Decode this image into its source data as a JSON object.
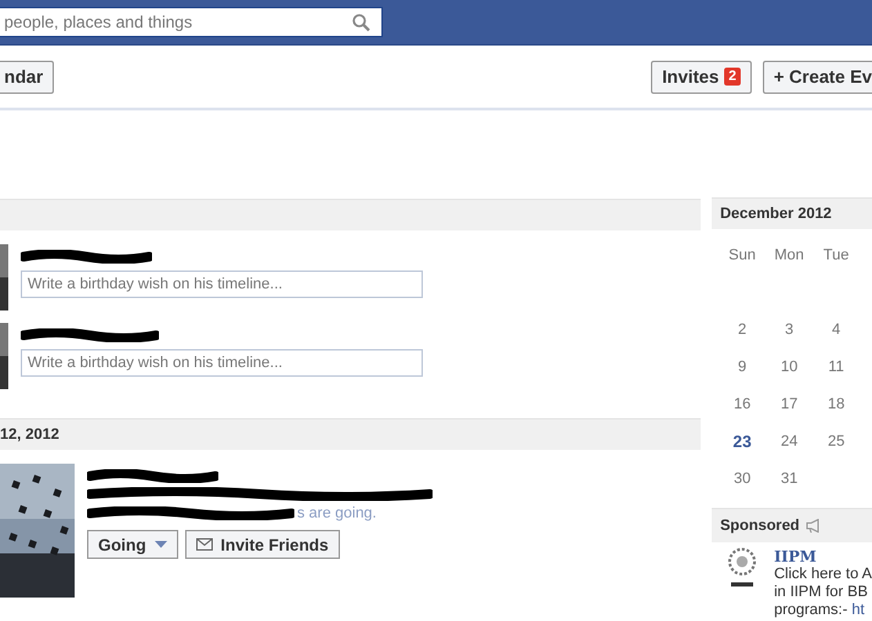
{
  "top_bar": {
    "search": {
      "placeholder": "people, places and things"
    }
  },
  "toolbar": {
    "left_button": "ndar",
    "invites": {
      "label": "Invites",
      "count": "2"
    },
    "create_button": "+ Create Ev"
  },
  "birthdays": [
    {
      "placeholder": "Write a birthday wish on his timeline..."
    },
    {
      "placeholder": "Write a birthday wish on his timeline..."
    }
  ],
  "event_section": {
    "date_heading": "12, 2012",
    "event": {
      "going_text": "s are going.",
      "buttons": [
        {
          "kind": "dropdown",
          "label": "Going"
        },
        {
          "kind": "mail",
          "label": "Invite Friends"
        }
      ]
    }
  },
  "calendar": {
    "title": "December 2012",
    "weekdays": [
      "Sun",
      "Mon",
      "Tue"
    ],
    "weeks": [
      [
        {
          "label": "2",
          "selected": false
        },
        {
          "label": "3",
          "selected": false
        },
        {
          "label": "4",
          "selected": false
        }
      ],
      [
        {
          "label": "9",
          "selected": false
        },
        {
          "label": "10",
          "selected": false
        },
        {
          "label": "11",
          "selected": false
        }
      ],
      [
        {
          "label": "16",
          "selected": false
        },
        {
          "label": "17",
          "selected": false
        },
        {
          "label": "18",
          "selected": false
        }
      ],
      [
        {
          "label": "23",
          "selected": true
        },
        {
          "label": "24",
          "selected": false
        },
        {
          "label": "25",
          "selected": false
        }
      ],
      [
        {
          "label": "30",
          "selected": false
        },
        {
          "label": "31",
          "selected": false
        }
      ]
    ]
  },
  "sponsored": {
    "title": "Sponsored",
    "ad": {
      "name": "IIPM",
      "lines": [
        "Click here to A",
        "in IIPM for BB",
        "programs:- "
      ],
      "link_fragment": "ht"
    }
  }
}
